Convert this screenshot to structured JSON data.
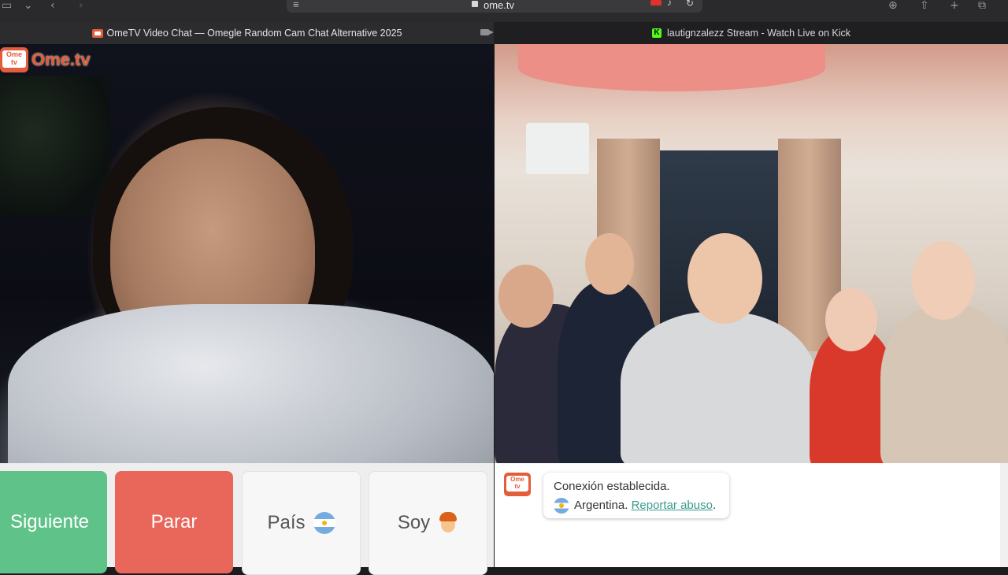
{
  "browser": {
    "url": "ome.tv",
    "tabs": [
      {
        "title": "OmeTV Video Chat — Omegle Random Cam Chat Alternative 2025",
        "favicon": "ometv-favicon"
      },
      {
        "title": "lautignzalezz Stream - Watch Live on Kick",
        "favicon": "kick-favicon"
      }
    ]
  },
  "logo": {
    "badge_text": "Ome\ntv",
    "word": "Ome.tv"
  },
  "controls": {
    "next_label": "Siguiente",
    "stop_label": "Parar",
    "country_label": "País",
    "self_label": "Soy"
  },
  "chat": {
    "logo_text": "Ome\ntv",
    "connection": "Conexión establecida.",
    "country": "Argentina.",
    "report_link": "Reportar abuso",
    "report_suffix": "."
  },
  "colors": {
    "next": "#5fc389",
    "stop": "#e8675a",
    "brand": "#e35d3a",
    "link": "#3a9b8c"
  }
}
